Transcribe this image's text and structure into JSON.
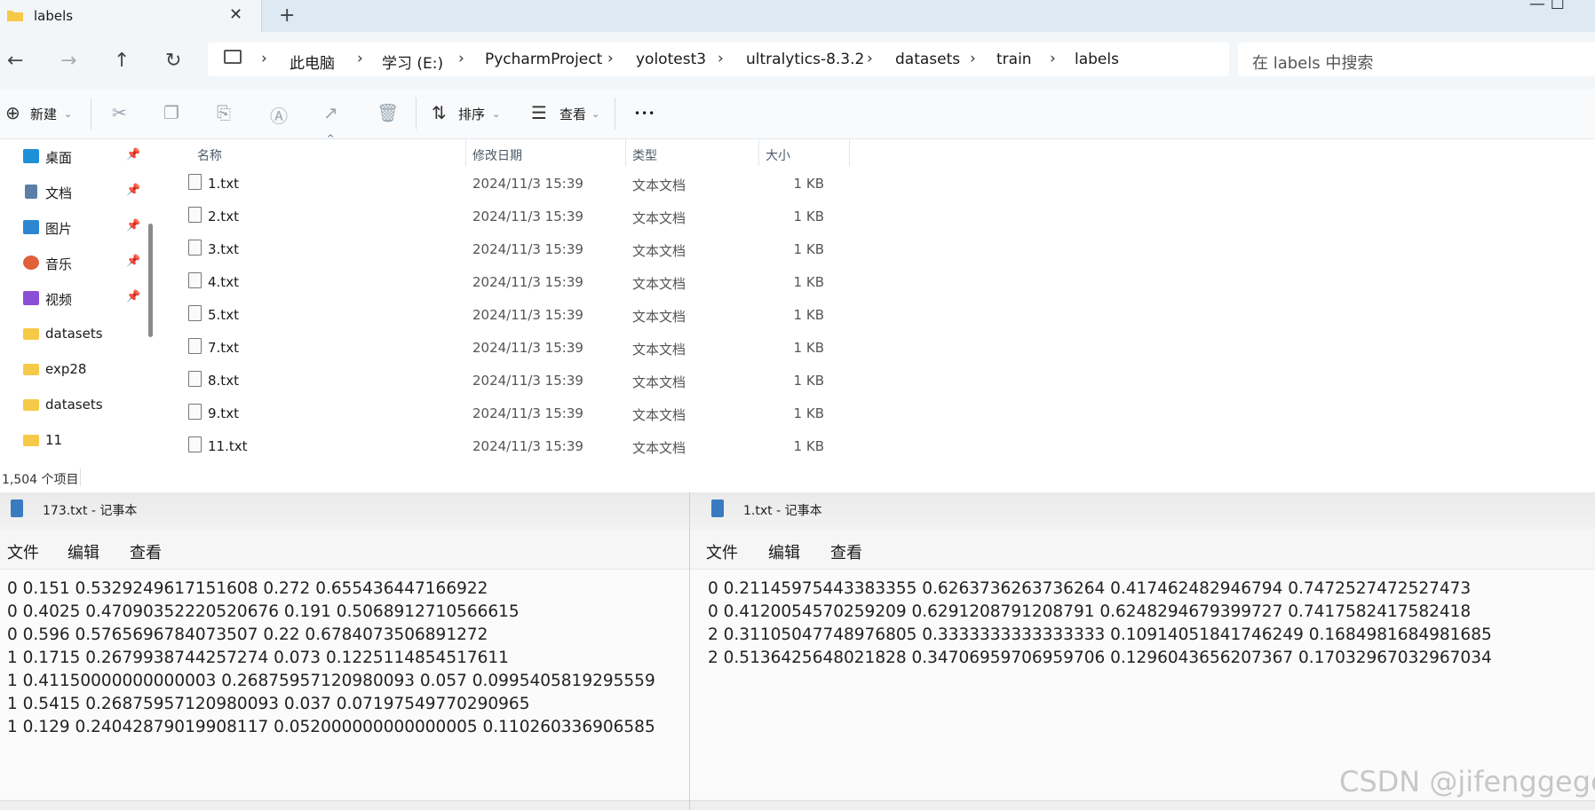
{
  "explorer": {
    "tab_title": "labels",
    "tab_close": "✕",
    "new_tab": "+",
    "window_controls": "— ☐",
    "nav": {
      "back": "←",
      "forward": "→",
      "up": "↑",
      "refresh": "↻"
    },
    "breadcrumbs": [
      "此电脑",
      "学习 (E:)",
      "PycharmProject",
      "yolotest3",
      "ultralytics-8.3.2",
      "datasets",
      "train",
      "labels"
    ],
    "breadcrumb_separator": "›",
    "search_placeholder": "在 labels 中搜索",
    "toolbar": {
      "new_label": "新建",
      "sort_label": "排序",
      "view_label": "查看",
      "more": "•••"
    },
    "sidebar": [
      {
        "label": "桌面",
        "icon": "desktop-icon",
        "color": "#1e90d6",
        "pinned": true
      },
      {
        "label": "文档",
        "icon": "document-icon",
        "color": "#5b7fa6",
        "pinned": true
      },
      {
        "label": "图片",
        "icon": "pictures-icon",
        "color": "#2d86d1",
        "pinned": true
      },
      {
        "label": "音乐",
        "icon": "music-icon",
        "color": "#e0603a",
        "pinned": true
      },
      {
        "label": "视频",
        "icon": "video-icon",
        "color": "#8a4fd6",
        "pinned": true
      },
      {
        "label": "datasets",
        "icon": "folder-icon",
        "color": "#f7c948",
        "pinned": false
      },
      {
        "label": "exp28",
        "icon": "folder-icon",
        "color": "#f7c948",
        "pinned": false
      },
      {
        "label": "datasets",
        "icon": "folder-icon",
        "color": "#f7c948",
        "pinned": false
      },
      {
        "label": "11",
        "icon": "folder-icon",
        "color": "#f7c948",
        "pinned": false
      }
    ],
    "columns": {
      "name": "名称",
      "date": "修改日期",
      "type": "类型",
      "size": "大小"
    },
    "files": [
      {
        "name": "1.txt",
        "date": "2024/11/3 15:39",
        "type": "文本文档",
        "size": "1 KB"
      },
      {
        "name": "2.txt",
        "date": "2024/11/3 15:39",
        "type": "文本文档",
        "size": "1 KB"
      },
      {
        "name": "3.txt",
        "date": "2024/11/3 15:39",
        "type": "文本文档",
        "size": "1 KB"
      },
      {
        "name": "4.txt",
        "date": "2024/11/3 15:39",
        "type": "文本文档",
        "size": "1 KB"
      },
      {
        "name": "5.txt",
        "date": "2024/11/3 15:39",
        "type": "文本文档",
        "size": "1 KB"
      },
      {
        "name": "7.txt",
        "date": "2024/11/3 15:39",
        "type": "文本文档",
        "size": "1 KB"
      },
      {
        "name": "8.txt",
        "date": "2024/11/3 15:39",
        "type": "文本文档",
        "size": "1 KB"
      },
      {
        "name": "9.txt",
        "date": "2024/11/3 15:39",
        "type": "文本文档",
        "size": "1 KB"
      },
      {
        "name": "11.txt",
        "date": "2024/11/3 15:39",
        "type": "文本文档",
        "size": "1 KB"
      }
    ],
    "status": "1,504 个项目"
  },
  "notepad_left": {
    "title": "173.txt - 记事本",
    "menu": [
      "文件",
      "编辑",
      "查看"
    ],
    "lines": [
      "0 0.151 0.5329249617151608 0.272 0.655436447166922",
      "0 0.4025 0.47090352220520676 0.191 0.5068912710566615",
      "0 0.596 0.5765696784073507 0.22 0.6784073506891272",
      "1 0.1715 0.2679938744257274 0.073 0.1225114854517611",
      "1 0.41150000000000003 0.26875957120980093 0.057 0.0995405819295559",
      "1 0.5415 0.26875957120980093 0.037 0.07197549770290965",
      "1 0.129 0.24042879019908117 0.052000000000000005 0.110260336906585"
    ]
  },
  "notepad_right": {
    "title": "1.txt - 记事本",
    "menu": [
      "文件",
      "编辑",
      "查看"
    ],
    "lines": [
      "0 0.21145975443383355 0.6263736263736264 0.417462482946794 0.7472527472527473",
      "0 0.4120054570259209 0.6291208791208791 0.6248294679399727 0.7417582417582418",
      "2 0.31105047748976805 0.3333333333333333 0.10914051841746249 0.1684981684981685",
      "2 0.5136425648021828 0.34706959706959706 0.1296043656207367 0.17032967032967034"
    ]
  },
  "watermark": "CSDN @jifenggege"
}
